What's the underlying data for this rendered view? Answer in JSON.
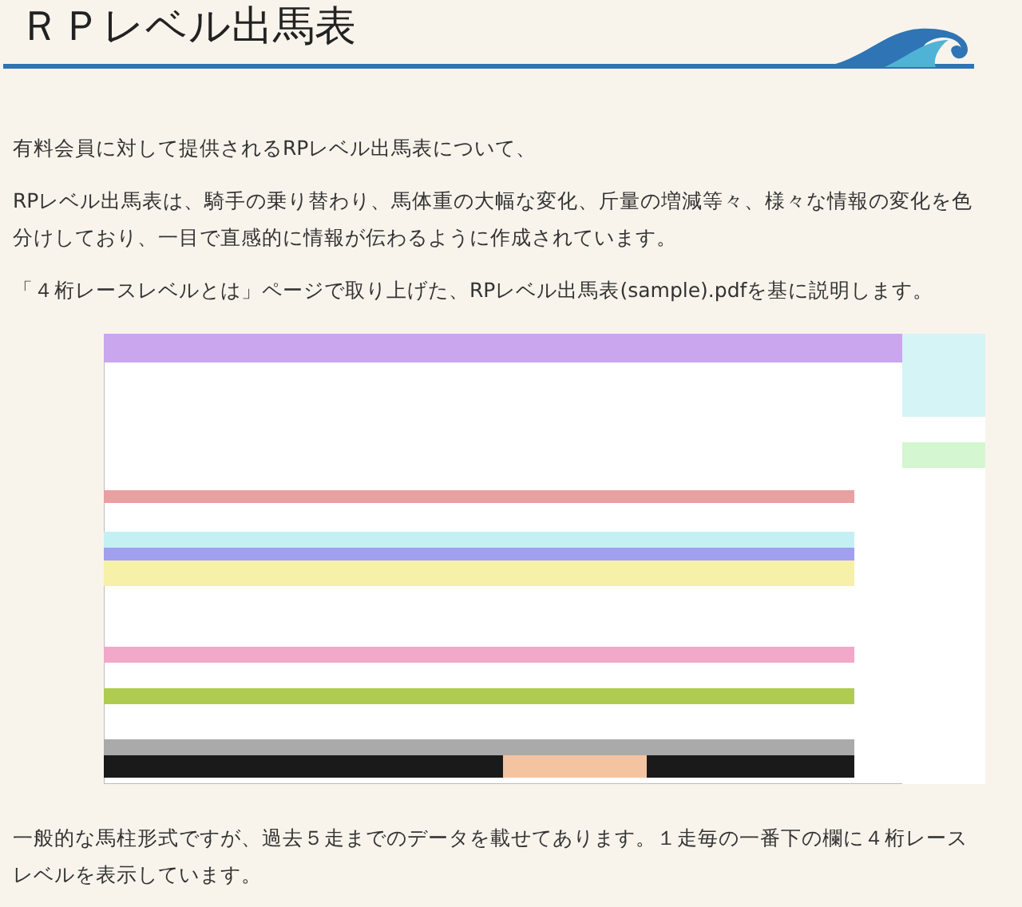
{
  "header": {
    "title": "ＲＰレベル出馬表"
  },
  "intro": [
    "有料会員に対して提供されるRPレベル出馬表について、",
    "RPレベル出馬表は、騎手の乗り替わり、馬体重の大幅な変化、斤量の増減等々、様々な情報の変化を色分けしており、一目で直感的に情報が伝わるように作成されています。",
    "「４桁レースレベルとは」ページで取り上げた、RPレベル出馬表(sample).pdfを基に説明します。"
  ],
  "closing": "一般的な馬柱形式ですが、過去５走までのデータを載せてあります。１走毎の一番下の欄に４桁レースレベルを表示しています。"
}
